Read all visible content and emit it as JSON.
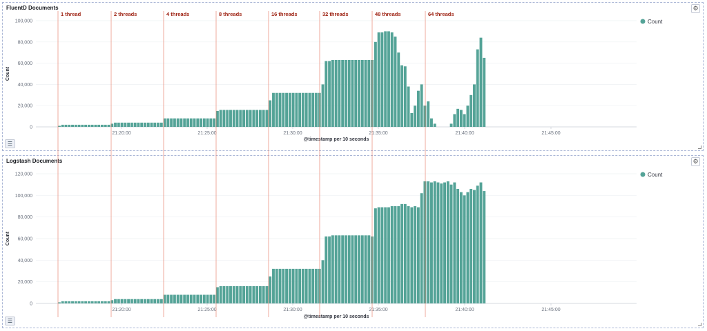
{
  "chart_data": [
    {
      "type": "bar",
      "title": "FluentD Documents",
      "xlabel": "@timestamp per 10 seconds",
      "ylabel": "Count",
      "ylim": [
        0,
        100000
      ],
      "yticks": [
        "0",
        "20,000",
        "40,000",
        "60,000",
        "80,000",
        "100,000"
      ],
      "xticks": [
        "21:20:00",
        "21:25:00",
        "21:30:00",
        "21:35:00",
        "21:40:00",
        "21:45:00"
      ],
      "legend": "top-right",
      "series": [
        {
          "name": "Count",
          "color": "#54a397",
          "values": [
            1000,
            2000,
            2000,
            2000,
            2000,
            2000,
            2000,
            2000,
            2000,
            2000,
            2000,
            2000,
            2000,
            2000,
            2000,
            2000,
            3000,
            4000,
            4000,
            4000,
            4000,
            4000,
            4000,
            4000,
            4000,
            4000,
            4000,
            4000,
            4000,
            4000,
            4000,
            4000,
            8000,
            8000,
            8000,
            8000,
            8000,
            8000,
            8000,
            8000,
            8000,
            8000,
            8000,
            8000,
            8000,
            8000,
            8000,
            8000,
            15000,
            16000,
            16000,
            16000,
            16000,
            16000,
            16000,
            16000,
            16000,
            16000,
            16000,
            16000,
            16000,
            16000,
            16000,
            16000,
            25000,
            32000,
            32000,
            32000,
            32000,
            32000,
            32000,
            32000,
            32000,
            32000,
            32000,
            32000,
            32000,
            32000,
            32000,
            32000,
            40000,
            62000,
            62000,
            63000,
            63000,
            63000,
            63000,
            63000,
            63000,
            63000,
            63000,
            63000,
            63000,
            63000,
            63000,
            63000,
            80000,
            89000,
            89000,
            90000,
            90000,
            89000,
            85000,
            70000,
            58000,
            57000,
            38000,
            13000,
            20000,
            34000,
            40000,
            20000,
            24000,
            8000,
            3000,
            0,
            0,
            0,
            0,
            3000,
            12000,
            17000,
            16000,
            12000,
            20000,
            30000,
            40000,
            73000,
            84000,
            65000
          ]
        }
      ],
      "annotations": [
        "1 thread",
        "2 threads",
        "4 threads",
        "8 threads",
        "16 threads",
        "32 threads",
        "48 threads",
        "64 threads"
      ]
    },
    {
      "type": "bar",
      "title": "Logstash Documents",
      "xlabel": "@timestamp per 10 seconds",
      "ylabel": "Count",
      "ylim": [
        0,
        120000
      ],
      "yticks": [
        "0",
        "20,000",
        "40,000",
        "60,000",
        "80,000",
        "100,000",
        "120,000"
      ],
      "xticks": [
        "21:20:00",
        "21:25:00",
        "21:30:00",
        "21:35:00",
        "21:40:00",
        "21:45:00"
      ],
      "legend": "top-right",
      "series": [
        {
          "name": "Count",
          "color": "#54a397",
          "values": [
            1000,
            2000,
            2000,
            2000,
            2000,
            2000,
            2000,
            2000,
            2000,
            2000,
            2000,
            2000,
            2000,
            2000,
            2000,
            2000,
            3000,
            4000,
            4000,
            4000,
            4000,
            4000,
            4000,
            4000,
            4000,
            4000,
            4000,
            4000,
            4000,
            4000,
            4000,
            4000,
            8000,
            8000,
            8000,
            8000,
            8000,
            8000,
            8000,
            8000,
            8000,
            8000,
            8000,
            8000,
            8000,
            8000,
            8000,
            8000,
            15000,
            16000,
            16000,
            16000,
            16000,
            16000,
            16000,
            16000,
            16000,
            16000,
            16000,
            16000,
            16000,
            16000,
            16000,
            16000,
            25000,
            32000,
            32000,
            32000,
            32000,
            32000,
            32000,
            32000,
            32000,
            32000,
            32000,
            32000,
            32000,
            32000,
            32000,
            32000,
            40000,
            62000,
            62000,
            63000,
            63000,
            63000,
            63000,
            63000,
            63000,
            63000,
            63000,
            63000,
            63000,
            63000,
            63000,
            62000,
            88000,
            89000,
            89000,
            89000,
            89000,
            90000,
            90000,
            90000,
            92000,
            92000,
            90000,
            89000,
            90000,
            89000,
            102000,
            113000,
            113000,
            112000,
            113000,
            112000,
            111000,
            112000,
            113000,
            110000,
            112000,
            106000,
            103000,
            100000,
            103000,
            106000,
            105000,
            109000,
            112000,
            104000
          ]
        }
      ],
      "annotations": []
    }
  ]
}
